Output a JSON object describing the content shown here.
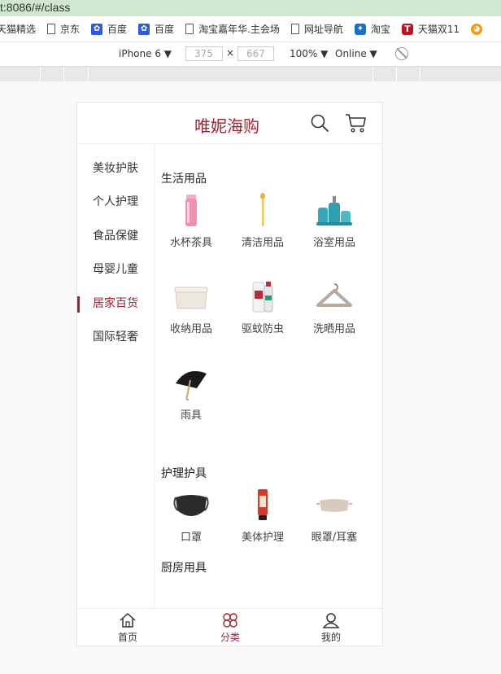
{
  "browser": {
    "url": "t:8086/#/class",
    "bookmarks": [
      {
        "label": "天猫精选",
        "icon": "none"
      },
      {
        "label": "京东",
        "icon": "doc-icon"
      },
      {
        "label": "百度",
        "icon": "paw-icon"
      },
      {
        "label": "百度",
        "icon": "paw-icon"
      },
      {
        "label": "淘宝嘉年华.主会场",
        "icon": "doc-icon"
      },
      {
        "label": "网址导航",
        "icon": "doc-icon"
      },
      {
        "label": "淘宝",
        "icon": "star-icon"
      },
      {
        "label": "天猫双11",
        "icon": "tmall-icon"
      },
      {
        "label": "",
        "icon": "extra-icon"
      }
    ],
    "devtools": {
      "device": "iPhone 6 ▼",
      "width": "375",
      "times": "×",
      "height": "667",
      "zoom": "100% ▼",
      "network": "Online ▼"
    }
  },
  "app": {
    "logo": "唯妮海购",
    "accent_color": "#a12232",
    "categories": [
      "美妆护肤",
      "个人护理",
      "食品保健",
      "母婴儿童",
      "居家百货",
      "国际轻奢"
    ],
    "active_category_index": 4,
    "sections": [
      {
        "title": "生活用品",
        "items": [
          {
            "label": "水杯茶具",
            "icon": "cup-icon"
          },
          {
            "label": "清洁用品",
            "icon": "brush-icon"
          },
          {
            "label": "浴室用品",
            "icon": "bath-set-icon"
          },
          {
            "label": "收纳用品",
            "icon": "storage-box-icon"
          },
          {
            "label": "驱蚊防虫",
            "icon": "repellent-icon"
          },
          {
            "label": "洗晒用品",
            "icon": "hanger-icon"
          },
          {
            "label": "雨具",
            "icon": "umbrella-icon"
          }
        ]
      },
      {
        "title": "护理护具",
        "items": [
          {
            "label": "口罩",
            "icon": "mask-icon"
          },
          {
            "label": "美体护理",
            "icon": "tube-icon"
          },
          {
            "label": "眼罩/耳塞",
            "icon": "eye-mask-icon"
          }
        ]
      },
      {
        "title": "厨房用具",
        "items": []
      }
    ],
    "tabs": [
      {
        "label": "首页",
        "icon": "home-icon"
      },
      {
        "label": "分类",
        "icon": "category-icon"
      },
      {
        "label": "我的",
        "icon": "user-icon"
      }
    ],
    "active_tab_index": 1
  }
}
